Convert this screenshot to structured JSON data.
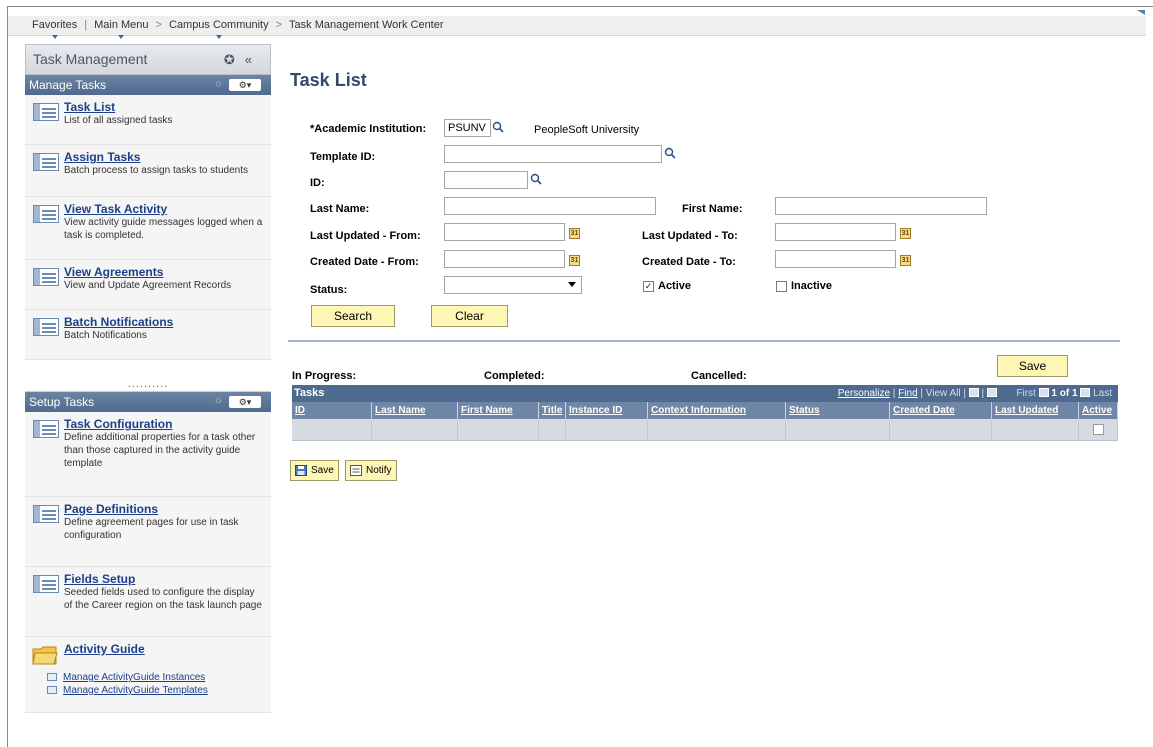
{
  "breadcrumb": {
    "favorites": "Favorites",
    "main_menu": "Main Menu",
    "campus_community": "Campus Community",
    "current": "Task Management Work Center",
    "separator": "|",
    "arrow": ">"
  },
  "sidebar": {
    "title": "Task Management",
    "manage_tasks_header": "Manage Tasks",
    "manage_tasks": [
      {
        "label": "Task List",
        "desc": "List of all assigned tasks"
      },
      {
        "label": "Assign Tasks",
        "desc": "Batch process to assign tasks to students"
      },
      {
        "label": "View Task Activity",
        "desc": "View activity guide messages logged when a task is completed."
      },
      {
        "label": "View Agreements",
        "desc": "View and Update Agreement Records"
      },
      {
        "label": "Batch Notifications",
        "desc": "Batch Notifications"
      }
    ],
    "ellipsis": "..........",
    "setup_tasks_header": "Setup Tasks",
    "setup_tasks": [
      {
        "label": "Task Configuration",
        "desc": "Define additional properties for a task other than those captured in the activity guide template"
      },
      {
        "label": "Page Definitions",
        "desc": "Define agreement pages for use in task configuration"
      },
      {
        "label": "Fields Setup",
        "desc": "Seeded fields used to configure the display of the Career region on the task launch page"
      }
    ],
    "activity_guide": {
      "label": "Activity Guide",
      "links": [
        "Manage ActivityGuide Instances",
        "Manage ActivityGuide Templates"
      ]
    }
  },
  "page": {
    "title": "Task List"
  },
  "form": {
    "academic_institution_label": "*Academic Institution:",
    "academic_institution_value": "PSUNV",
    "academic_institution_desc": "PeopleSoft University",
    "template_id_label": "Template ID:",
    "template_id_value": "",
    "id_label": "ID:",
    "id_value": "",
    "last_name_label": "Last Name:",
    "last_name_value": "",
    "first_name_label": "First Name:",
    "first_name_value": "",
    "last_updated_from_label": "Last Updated - From:",
    "last_updated_to_label": "Last Updated - To:",
    "created_date_from_label": "Created Date - From:",
    "created_date_to_label": "Created Date - To:",
    "status_label": "Status:",
    "status_value": "",
    "active_label": "Active",
    "active_checked": true,
    "inactive_label": "Inactive",
    "inactive_checked": false,
    "search_button": "Search",
    "clear_button": "Clear"
  },
  "summary": {
    "in_progress_label": "In Progress:",
    "completed_label": "Completed:",
    "cancelled_label": "Cancelled:",
    "save_button": "Save"
  },
  "grid": {
    "title": "Tasks",
    "personalize": "Personalize",
    "find": "Find",
    "view_all": "View All",
    "first": "First",
    "range": "1 of 1",
    "last": "Last",
    "columns": [
      "ID",
      "Last Name",
      "First Name",
      "Title",
      "Instance ID",
      "Context Information",
      "Status",
      "Created Date",
      "Last Updated",
      "Active"
    ]
  },
  "toolbar": {
    "save": "Save",
    "notify": "Notify"
  },
  "colors": {
    "header_blue": "#4f6a8f",
    "link_blue": "#1d3f8a",
    "button_yellow": "#fdf6b5",
    "title_color": "#2f4a6d"
  }
}
